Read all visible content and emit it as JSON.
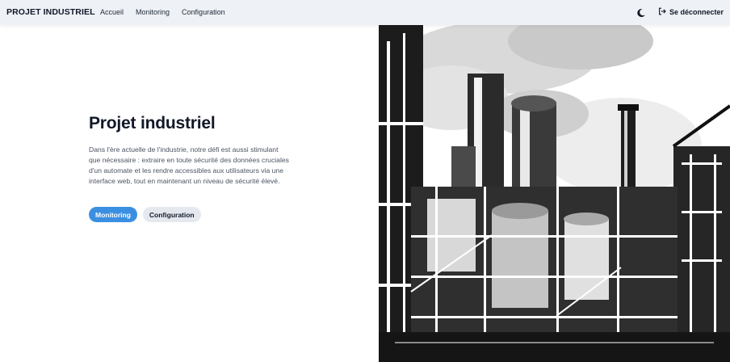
{
  "nav": {
    "brand": "PROJET INDUSTRIEL",
    "links": [
      "Accueil",
      "Monitoring",
      "Configuration"
    ],
    "theme_icon": "moon-icon",
    "logout_icon": "logout-icon",
    "logout_label": "Se déconnecter"
  },
  "hero": {
    "title": "Projet industriel",
    "description": "Dans l'ère actuelle de l'industrie, notre défi est aussi stimulant que nécessaire : extraire en toute sécurité des données cruciales d'un automate et les rendre accessibles aux utilisateurs via une interface web, tout en maintenant un niveau de sécurité élevé.",
    "primary_button": "Monitoring",
    "secondary_button": "Configuration",
    "image_icon": "industrial-plant-illustration"
  },
  "colors": {
    "navbar_bg": "#eef1f5",
    "accent": "#3b8fe0",
    "title_highlight": "#8ec9f5",
    "secondary_button_bg": "#e5e9ef"
  }
}
